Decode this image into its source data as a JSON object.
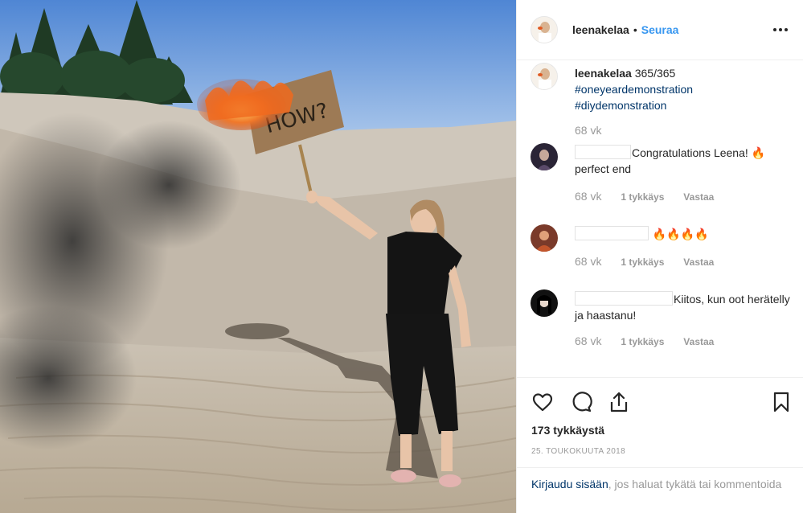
{
  "photo": {
    "sign_text": "HOW?"
  },
  "header": {
    "username": "leenakelaa",
    "separator": "•",
    "follow_label": "Seuraa"
  },
  "caption": {
    "username": "leenakelaa",
    "text": "365/365",
    "hashtags": [
      "#oneyeardemonstration",
      "#diydemonstration"
    ],
    "time": "68 vk"
  },
  "comments": [
    {
      "text": "Congratulations Leena! 🔥 perfect end",
      "time": "68 vk",
      "likes": "1 tykkäys",
      "reply": "Vastaa"
    },
    {
      "text": "🔥🔥🔥🔥",
      "time": "68 vk",
      "likes": "1 tykkäys",
      "reply": "Vastaa"
    },
    {
      "text": "Kiitos, kun oot herätelly ja haastanu!",
      "time": "68 vk",
      "likes": "1 tykkäys",
      "reply": "Vastaa"
    }
  ],
  "actions": {
    "like_icon": "heart-icon",
    "comment_icon": "comment-icon",
    "share_icon": "share-icon",
    "save_icon": "bookmark-icon",
    "likes_count": "173 tykkäystä",
    "date": "25. TOUKOKUUTA 2018"
  },
  "login": {
    "link": "Kirjaudu sisään",
    "rest": ", jos haluat tykätä tai kommentoida"
  },
  "colors": {
    "accent": "#3897f0",
    "hashtag": "#003569",
    "muted": "#999999",
    "text": "#262626",
    "flame": "#f06a1f"
  }
}
